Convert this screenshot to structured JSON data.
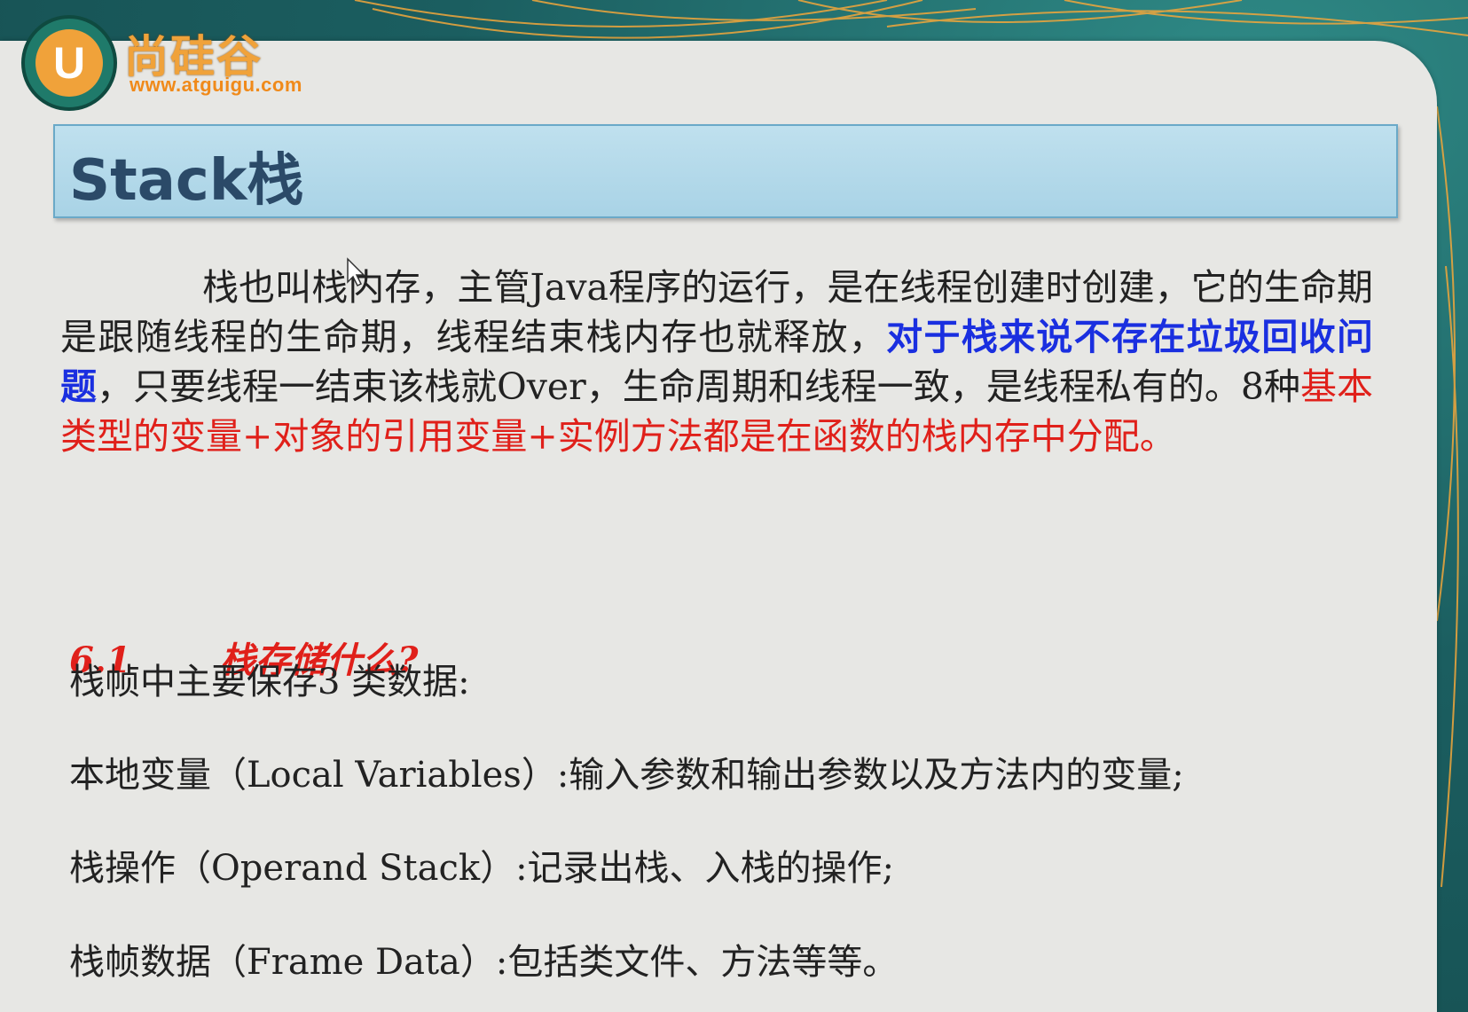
{
  "branding": {
    "logo_letter": "U",
    "name": "尚硅谷",
    "url": "www.atguigu.com"
  },
  "slide": {
    "title": "Stack栈",
    "paragraph": {
      "part1": "栈也叫栈内存，主管Java程序的运行，是在线程创建时创建，它的生命期是跟随线程的生命期，线程结束栈内存也就释放，",
      "highlight_blue": "对于栈来说不存在垃圾回收问题",
      "part2": "，只要线程一结束该栈就Over，生命周期和线程一致，是线程私有的。8种",
      "highlight_red": "基本类型的变量+对象的引用变量+实例方法都是在函数的栈内存中分配。"
    },
    "section": {
      "number": "6.1",
      "title": "栈存储什么?"
    },
    "lines": [
      "栈帧中主要保存3 类数据:",
      "本地变量（Local Variables）:输入参数和输出参数以及方法内的变量;",
      "栈操作（Operand Stack）:记录出栈、入栈的操作;",
      "栈帧数据（Frame Data）:包括类文件、方法等等。"
    ]
  },
  "colors": {
    "accent_blue": "#1a2fe0",
    "accent_red": "#e0201a",
    "title_bar": "#bfe0ee",
    "brand_orange": "#f0a23a"
  }
}
